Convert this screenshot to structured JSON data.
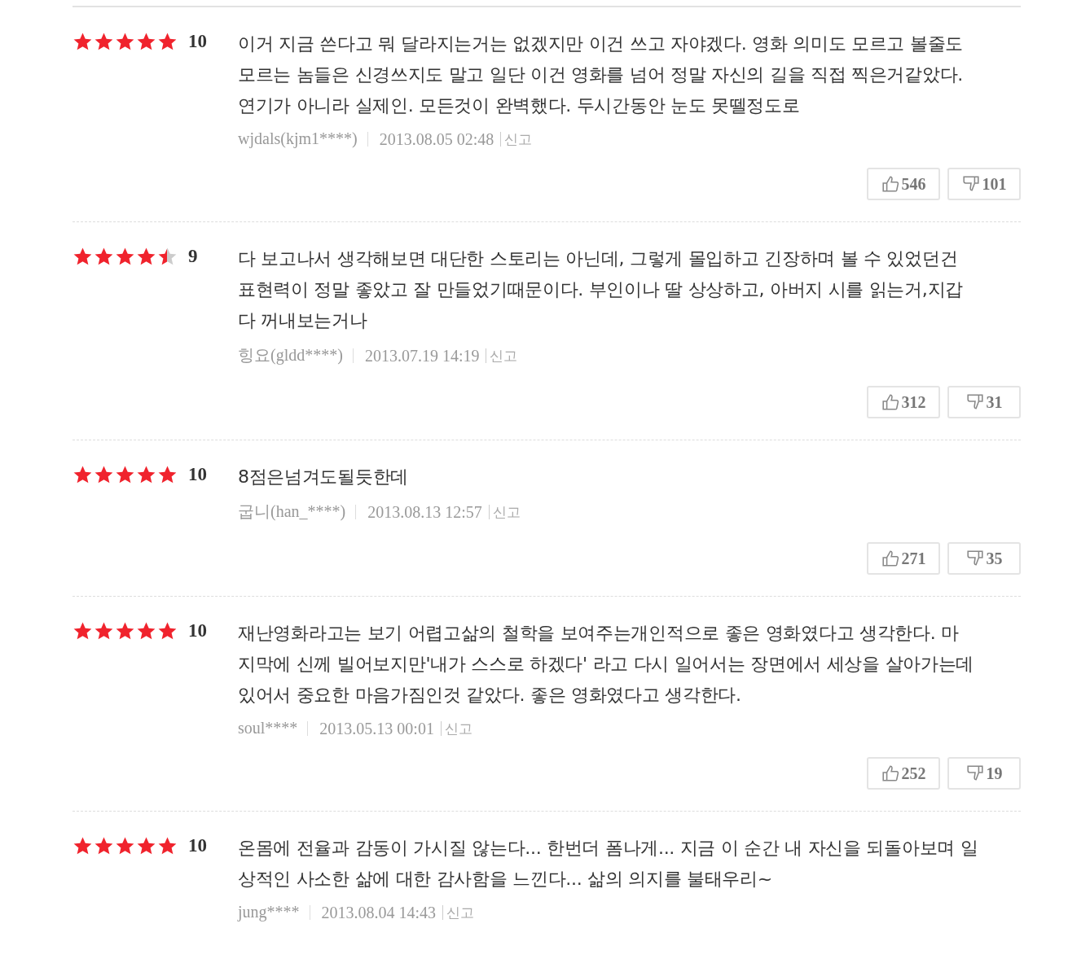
{
  "reviews": [
    {
      "stars": 5,
      "score": "10",
      "lines": [
        "이거 지금 쓴다고 뭐 달라지는거는 없겠지만 이건 쓰고 자야겠다. 영화 의미도 모르고 볼줄도",
        "모르는 놈들은 신경쓰지도 말고 일단 이건 영화를 넘어 정말 자신의 길을 직접 찍은거같았다.",
        "연기가 아니라 실제인. 모든것이 완벽했다. 두시간동안 눈도 못뗄정도로"
      ],
      "author": "wjdals(kjm1****)",
      "date": "2013.08.05 02:48",
      "report": "신고",
      "likes": "546",
      "dislikes": "101"
    },
    {
      "stars": 4.5,
      "score": "9",
      "lines": [
        "다 보고나서 생각해보면 대단한 스토리는 아닌데, 그렇게 몰입하고 긴장하며 볼 수 있었던건",
        "표현력이 정말 좋았고 잘 만들었기때문이다. 부인이나 딸 상상하고, 아버지 시를 읽는거,지갑",
        "다 꺼내보는거나"
      ],
      "author": "힝요(gldd****)",
      "date": "2013.07.19 14:19",
      "report": "신고",
      "likes": "312",
      "dislikes": "31"
    },
    {
      "stars": 5,
      "score": "10",
      "lines": [
        "8점은넘겨도될듯한데"
      ],
      "author": "굽니(han_****)",
      "date": "2013.08.13 12:57",
      "report": "신고",
      "likes": "271",
      "dislikes": "35"
    },
    {
      "stars": 5,
      "score": "10",
      "lines": [
        "재난영화라고는 보기 어렵고삶의 철학을 보여주는개인적으로 좋은 영화였다고 생각한다. 마",
        "지막에 신께 빌어보지만'내가 스스로 하겠다' 라고 다시 일어서는 장면에서 세상을 살아가는데",
        "있어서 중요한 마음가짐인것 같았다. 좋은 영화였다고 생각한다."
      ],
      "author": "soul****",
      "date": "2013.05.13 00:01",
      "report": "신고",
      "likes": "252",
      "dislikes": "19"
    },
    {
      "stars": 5,
      "score": "10",
      "lines": [
        "온몸에 전율과 감동이 가시질 않는다... 한번더 폼나게... 지금 이 순간 내 자신을 되돌아보며 일",
        "상적인 사소한 삶에 대한 감사함을 느낀다... 삶의 의지를 불태우리~"
      ],
      "author": "jung****",
      "date": "2013.08.04 14:43",
      "report": "신고"
    }
  ]
}
